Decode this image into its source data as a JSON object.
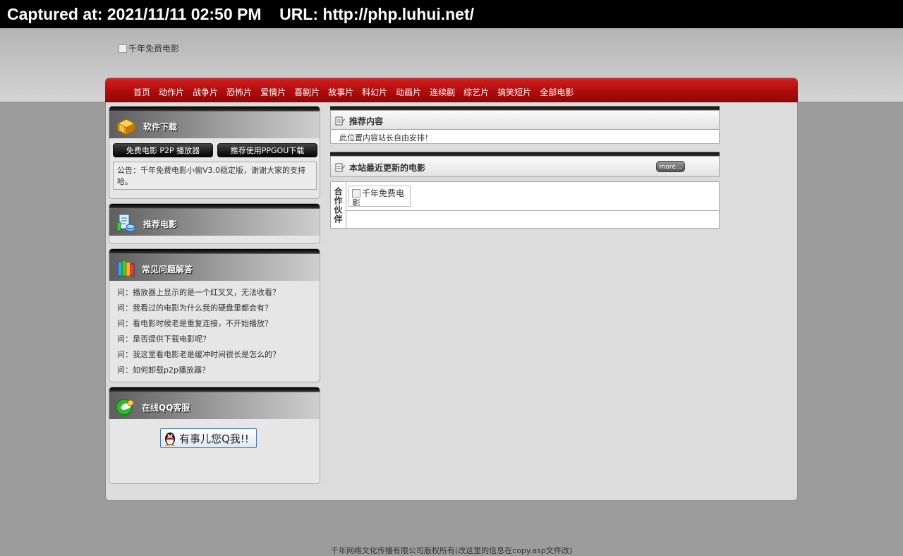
{
  "capture": {
    "text": "Captured at: 2021/11/11 02:50 PM    URL: http://php.luhui.net/"
  },
  "logo": {
    "alt": "千年免费电影"
  },
  "nav": {
    "items": [
      "首页",
      "动作片",
      "战争片",
      "恐怖片",
      "爱情片",
      "喜剧片",
      "故事片",
      "科幻片",
      "动画片",
      "连续剧",
      "综艺片",
      "搞笑短片",
      "全部电影"
    ]
  },
  "sidebar": {
    "download": {
      "title": "软件下载",
      "btn1": "免费电影 P2P 播放器",
      "btn2": "推荐使用PPGOU下载",
      "notice": "公告：千年免费电影小偷V3.0稳定版，谢谢大家的支持哈。"
    },
    "recommend": {
      "title": "推荐电影"
    },
    "faq": {
      "title": "常见问题解答",
      "items": [
        "问：播放器上显示的是一个红叉叉，无法收看？",
        "问：我看过的电影为什么我的硬盘里都会有？",
        "问：看电影时候老是重复连接，不开始播放？",
        "问：是否提供下载电影呢？",
        "问：我这里看电影老是缓冲时间很长是怎么的？",
        "问：如何卸载p2p播放器？"
      ]
    },
    "qq": {
      "title": "在线QQ客服",
      "button": "有事儿您Q我!!"
    }
  },
  "main": {
    "recommended": {
      "title": "推荐内容",
      "body": "此位置内容站长自由安排！"
    },
    "latest": {
      "title": "本站最近更新的电影",
      "more": "more..."
    },
    "partners": {
      "label": "合作伙伴",
      "logo_alt": "千年免费电影"
    }
  },
  "footer": {
    "text": "千年网络文化传播有限公司版权所有(改这里的信息在copy.asp文件改)"
  }
}
